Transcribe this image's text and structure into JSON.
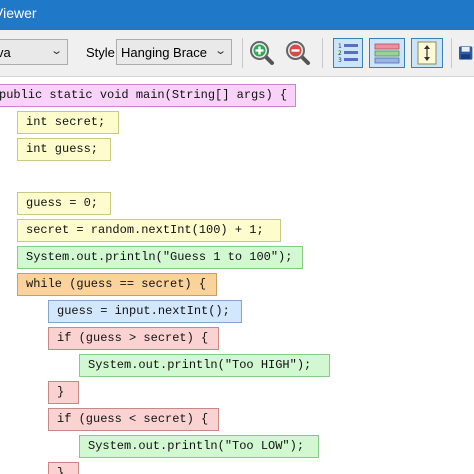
{
  "window": {
    "title": "Viewer",
    "accent": "#1f78c8"
  },
  "toolbar": {
    "language_value": "va",
    "style_label": "Style",
    "style_value": "Hanging Brace",
    "zoom_in_icon": "zoom-in-icon",
    "zoom_out_icon": "zoom-out-icon",
    "line_numbers_icon": "line-numbers-icon",
    "color_blocks_icon": "color-blocks-icon",
    "fit_height_icon": "fit-height-icon",
    "save_icon": "save-icon"
  },
  "code_blocks": [
    {
      "text": "public static void main(String[] args) {",
      "color": "lavender"
    },
    {
      "text": "int secret;",
      "color": "yellow"
    },
    {
      "text": "int guess;",
      "color": "yellow"
    },
    {
      "text": "guess = 0;",
      "color": "yellow"
    },
    {
      "text": "secret = random.nextInt(100) + 1;",
      "color": "yellow"
    },
    {
      "text": "System.out.println(\"Guess 1 to 100\");",
      "color": "green"
    },
    {
      "text": "while (guess == secret) {",
      "color": "orange"
    },
    {
      "text": "guess = input.nextInt();",
      "color": "blue"
    },
    {
      "text": "if (guess > secret) {",
      "color": "red"
    },
    {
      "text": "System.out.println(\"Too HIGH\");",
      "color": "green"
    },
    {
      "text": "}",
      "color": "red"
    },
    {
      "text": "if (guess < secret) {",
      "color": "red"
    },
    {
      "text": "System.out.println(\"Too LOW\");",
      "color": "green"
    },
    {
      "text": "}",
      "color": "red"
    }
  ],
  "colors": {
    "lavender": "#f8d2f8",
    "yellow": "#fcfccd",
    "green": "#d2f8d2",
    "orange": "#fad29b",
    "blue": "#d2e6fc",
    "red": "#fad2d2"
  }
}
